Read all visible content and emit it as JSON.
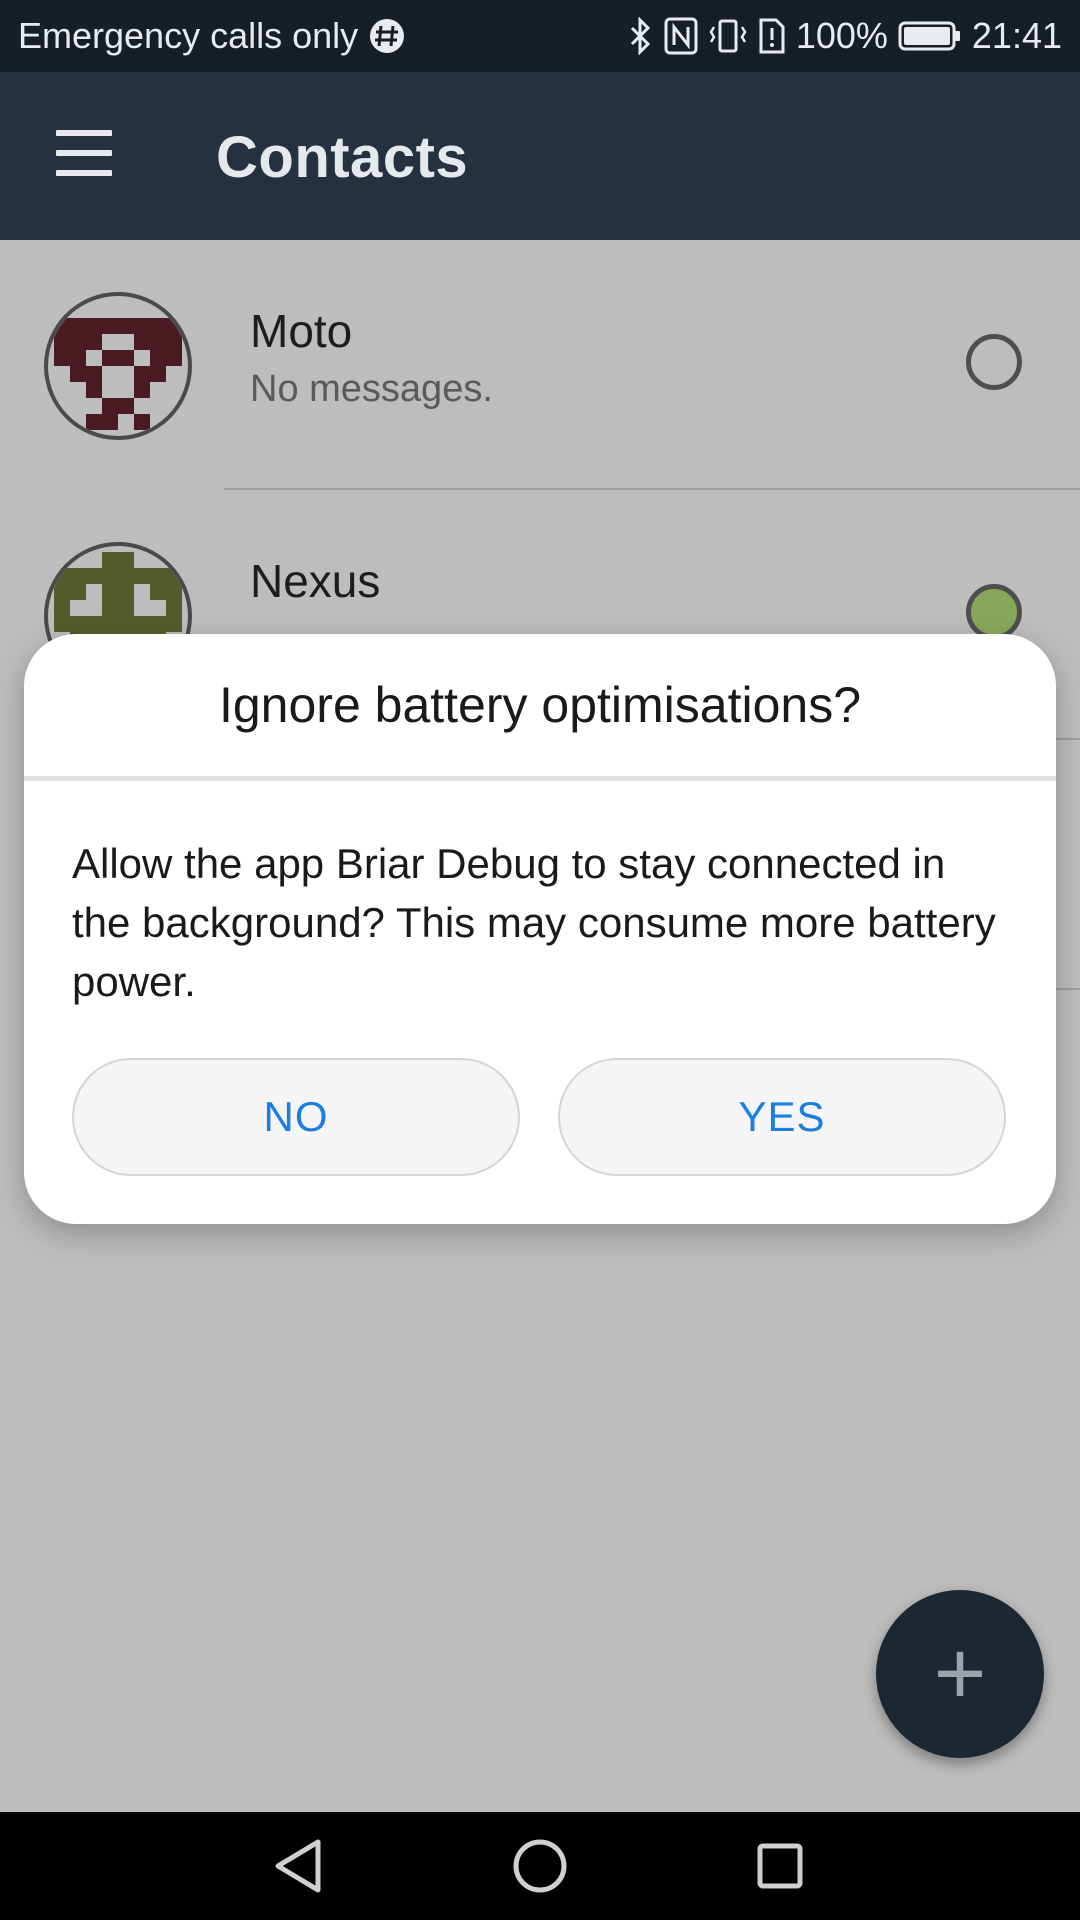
{
  "status_bar": {
    "carrier": "Emergency calls only",
    "battery": "100%",
    "time": "21:41"
  },
  "app_bar": {
    "title": "Contacts"
  },
  "contacts": [
    {
      "name": "Moto",
      "last_message": "No messages.",
      "online": false
    },
    {
      "name": "Nexus",
      "last_message": "",
      "online": true
    }
  ],
  "dialog": {
    "title": "Ignore battery optimisations?",
    "message": "Allow the app Briar Debug to stay connected in the background? This may consume more battery power.",
    "no_label": "NO",
    "yes_label": "YES"
  },
  "fab": {
    "label": "+"
  },
  "colors": {
    "accent": "#1a7fe0",
    "app_bar": "#25313e",
    "online_dot": "#87a85b"
  }
}
